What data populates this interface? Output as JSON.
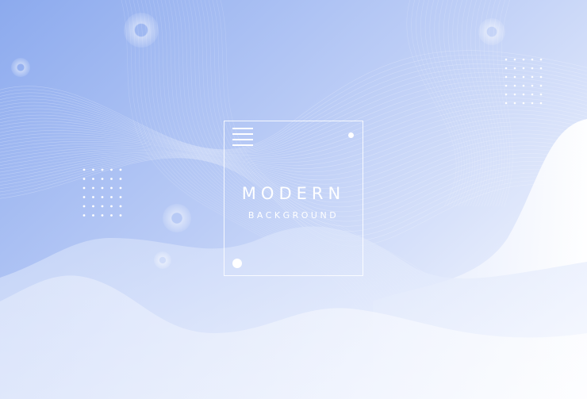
{
  "card": {
    "title": "MODERN",
    "subtitle": "BACKGROUND"
  },
  "colors": {
    "gradient_start": "#8eabee",
    "gradient_end": "#ffffff",
    "wave_light": "#e9f0fd",
    "accent_white": "#ffffff"
  },
  "icons": {
    "menu": "menu-icon",
    "dot_pattern": "dot-grid-icon",
    "ring": "ring-icon"
  }
}
